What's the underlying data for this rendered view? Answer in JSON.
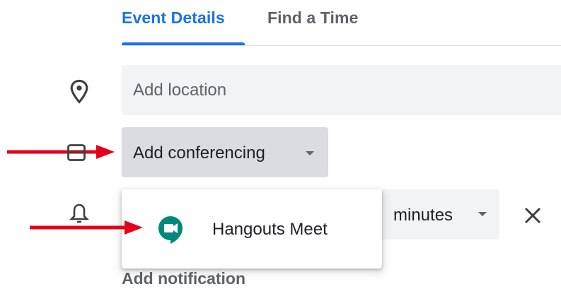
{
  "tabs": [
    {
      "label": "Event Details",
      "active": true
    },
    {
      "label": "Find a Time",
      "active": false
    }
  ],
  "location": {
    "placeholder": "Add location",
    "value": ""
  },
  "conferencing": {
    "button_label": "Add conferencing"
  },
  "dropdown": {
    "items": [
      {
        "label": "Hangouts Meet",
        "icon": "hangouts-meet-icon"
      }
    ]
  },
  "notification": {
    "unit_label": "minutes"
  },
  "add_notification_label": "Add notification",
  "colors": {
    "accent": "#1a73e8",
    "field_bg": "#f1f3f4",
    "button_bg": "#dadce0",
    "arrow": "#e3001b",
    "meet_green": "#00897b"
  }
}
